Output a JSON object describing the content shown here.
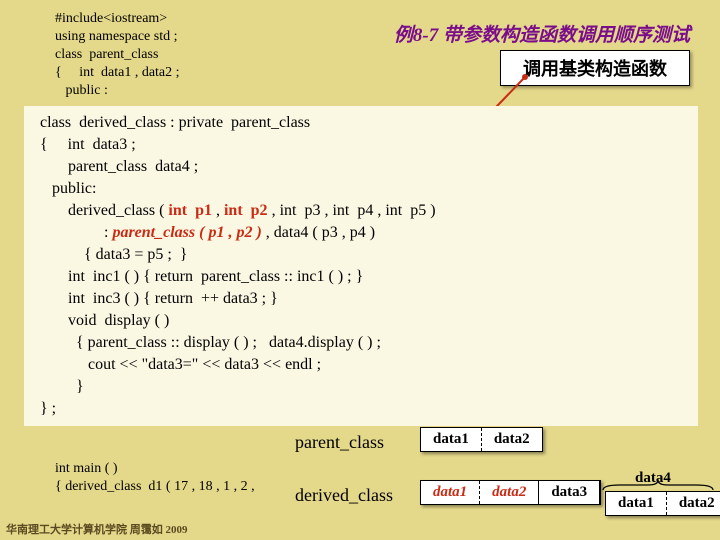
{
  "title": "例8-7  带参数构造函数调用顺序测试",
  "callout": "调用基类构造函数",
  "top_code": {
    "l1": "#include<iostream>",
    "l2": "using namespace std ;",
    "l3": "class  parent_class",
    "l4": "{     int  data1 , data2 ;",
    "l5": "   public :"
  },
  "code": {
    "l1": "class  derived_class : private  parent_class",
    "l2": "{     int  data3 ;",
    "l3": "       parent_class  data4 ;",
    "l4": "   public:",
    "l5a": "       derived_class ( ",
    "intp1": "int  p1 ",
    "comma1": ", ",
    "intp2": "int  p2 ",
    "l5b": ", int  p3 , int  p4 , int  p5 )",
    "l6a": "                : ",
    "pcl": "parent_class ( p1 , p2 ) ",
    "l6b": ", data4 ( p3 , p4 )",
    "l7": "           { data3 = p5 ;  }",
    "l8": "       int  inc1 ( ) { return  parent_class :: inc1 ( ) ; }",
    "l9": "       int  inc3 ( ) { return  ++ data3 ; }",
    "l10": "       void  display ( )",
    "l11": "         { parent_class :: display ( ) ;   data4.display ( ) ;",
    "l12": "            cout << \"data3=\" << data3 << endl ;",
    "l13": "         }",
    "l14": "} ;"
  },
  "bottom_code": {
    "l1": "int main ( )",
    "l2": "{ derived_class  d1 ( 17 , 18 , 1 , 2 ,"
  },
  "labels": {
    "parent_class": "parent_class",
    "derived_class": "derived_class"
  },
  "table_pc": {
    "c1": "data1",
    "c2": "data2"
  },
  "table_dc": {
    "c1": "data1",
    "c2": "data2",
    "c3": "data3"
  },
  "table_d4": {
    "label": "data4",
    "c1": "data1",
    "c2": "data2"
  },
  "footer": "华南理工大学计算机学院 周霭如 2009"
}
